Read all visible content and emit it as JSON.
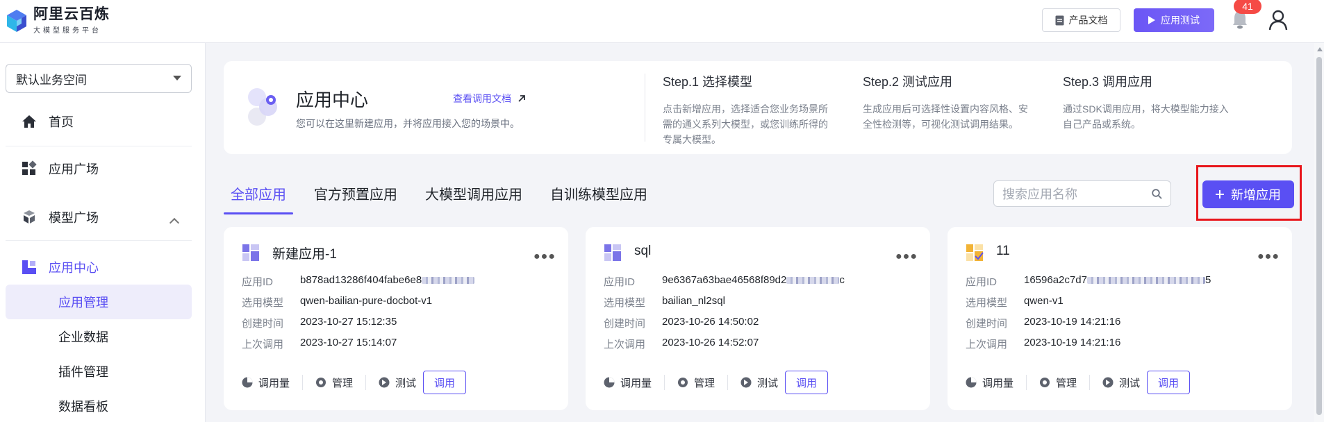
{
  "header": {
    "logo_title": "阿里云百炼",
    "logo_subtitle": "大模型服务平台",
    "doc_button": "产品文档",
    "test_button": "应用测试",
    "notification_count": "41"
  },
  "sidebar": {
    "workspace": "默认业务空间",
    "items": [
      {
        "label": "首页",
        "icon": "home-icon"
      },
      {
        "label": "应用广场",
        "icon": "grid-icon"
      },
      {
        "label": "模型广场",
        "icon": "cubes-icon"
      },
      {
        "label": "应用中心",
        "icon": "app-center-icon"
      }
    ],
    "sub_items": [
      {
        "label": "应用管理",
        "selected": true
      },
      {
        "label": "企业数据"
      },
      {
        "label": "插件管理"
      },
      {
        "label": "数据看板"
      }
    ]
  },
  "banner": {
    "title": "应用中心",
    "description": "您可以在这里新建应用，并将应用接入您的场景中。",
    "doc_link": "查看调用文档",
    "steps": [
      {
        "title": "Step.1 选择模型",
        "body": "点击新增应用，选择适合您业务场景所需的通义系列大模型，或您训练所得的专属大模型。"
      },
      {
        "title": "Step.2 测试应用",
        "body": "生成应用后可选择性设置内容风格、安全性检测等，可视化测试调用结果。"
      },
      {
        "title": "Step.3 调用应用",
        "body": "通过SDK调用应用，将大模型能力接入自己产品或系统。"
      }
    ]
  },
  "tabs": [
    "全部应用",
    "官方预置应用",
    "大模型调用应用",
    "自训练模型应用"
  ],
  "search": {
    "placeholder": "搜索应用名称"
  },
  "add_button": "新增应用",
  "field_labels": {
    "id": "应用ID",
    "model": "选用模型",
    "created": "创建时间",
    "last_call": "上次调用"
  },
  "actions": {
    "usage": "调用量",
    "manage": "管理",
    "test": "测试",
    "call": "调用"
  },
  "colors": {
    "accent": "#5a4ff3",
    "highlight": "#e8151b",
    "badge": "#f54a45"
  },
  "cards": [
    {
      "name": "新建应用-1",
      "id_prefix": "b878ad13286f404fabe6e8",
      "id_suffix": "",
      "model": "qwen-bailian-pure-docbot-v1",
      "created": "2023-10-27 15:12:35",
      "last_call": "2023-10-27 15:14:07",
      "icon_color": "#7b74e8"
    },
    {
      "name": "sql",
      "id_prefix": "9e6367a63bae46568f89d2",
      "id_suffix": "c",
      "model": "bailian_nl2sql",
      "created": "2023-10-26 14:50:02",
      "last_call": "2023-10-26 14:52:07",
      "icon_color": "#7b74e8"
    },
    {
      "name": "11",
      "id_prefix": "16596a2c7d7",
      "id_suffix": "5",
      "model": "qwen-v1",
      "created": "2023-10-19 14:21:16",
      "last_call": "2023-10-19 14:21:16",
      "icon_color": "#f2b335"
    }
  ]
}
